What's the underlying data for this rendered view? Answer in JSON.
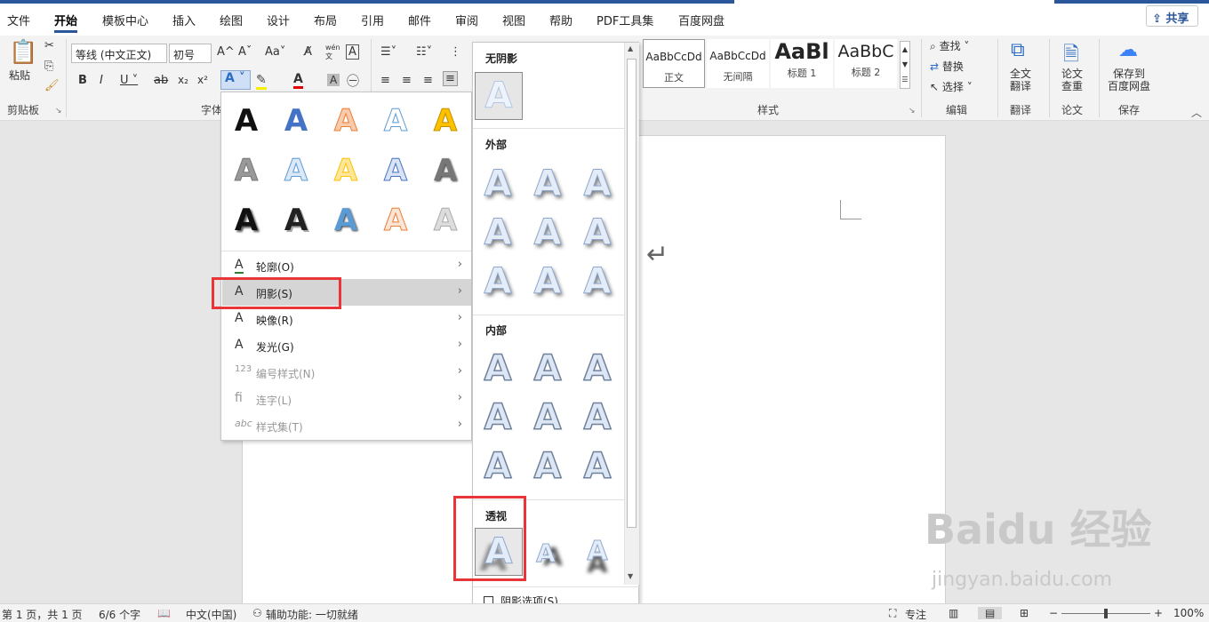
{
  "menu_tabs": [
    "文件",
    "开始",
    "模板中心",
    "插入",
    "绘图",
    "设计",
    "布局",
    "引用",
    "邮件",
    "审阅",
    "视图",
    "帮助",
    "PDF工具集",
    "百度网盘"
  ],
  "share_label": "共享",
  "ribbon": {
    "paste_label": "粘贴",
    "clipboard_label": "剪贴板",
    "font_name": "等线 (中文正文)",
    "font_size": "初号",
    "font_group_label": "字体",
    "styles": [
      {
        "preview": "AaBbCcDd",
        "name": "正文"
      },
      {
        "preview": "AaBbCcDd",
        "name": "无间隔"
      },
      {
        "preview": "AaBl",
        "name": "标题 1"
      },
      {
        "preview": "AaBbC",
        "name": "标题 2"
      }
    ],
    "styles_group_label": "样式",
    "find_label": "查找",
    "replace_label": "替换",
    "select_label": "选择",
    "edit_group_label": "编辑",
    "translate_btn": "全文\n翻译",
    "translate_label": "翻译",
    "paper_btn": "论文\n查重",
    "paper_label": "论文",
    "save_btn": "保存到\n百度网盘",
    "save_label": "保存"
  },
  "text_effects_menu": {
    "items": [
      {
        "label": "轮廓(O)",
        "enabled": true
      },
      {
        "label": "阴影(S)",
        "enabled": true,
        "highlighted": true
      },
      {
        "label": "映像(R)",
        "enabled": true
      },
      {
        "label": "发光(G)",
        "enabled": true
      },
      {
        "label": "编号样式(N)",
        "enabled": false
      },
      {
        "label": "连字(L)",
        "enabled": false
      },
      {
        "label": "样式集(T)",
        "enabled": false
      }
    ]
  },
  "shadow_panel": {
    "sections": [
      "无阴影",
      "外部",
      "内部",
      "透视"
    ],
    "options_label": "阴影选项(S)..."
  },
  "document": {
    "return_mark": "↵"
  },
  "status": {
    "page": "第 1 页，共 1 页",
    "words": "6/6 个字",
    "language": "中文(中国)",
    "accessibility": "辅助功能: 一切就绪",
    "focus": "专注",
    "zoom": "100%"
  },
  "watermark": {
    "brand": "Baidu 经验",
    "url": "jingyan.baidu.com"
  }
}
